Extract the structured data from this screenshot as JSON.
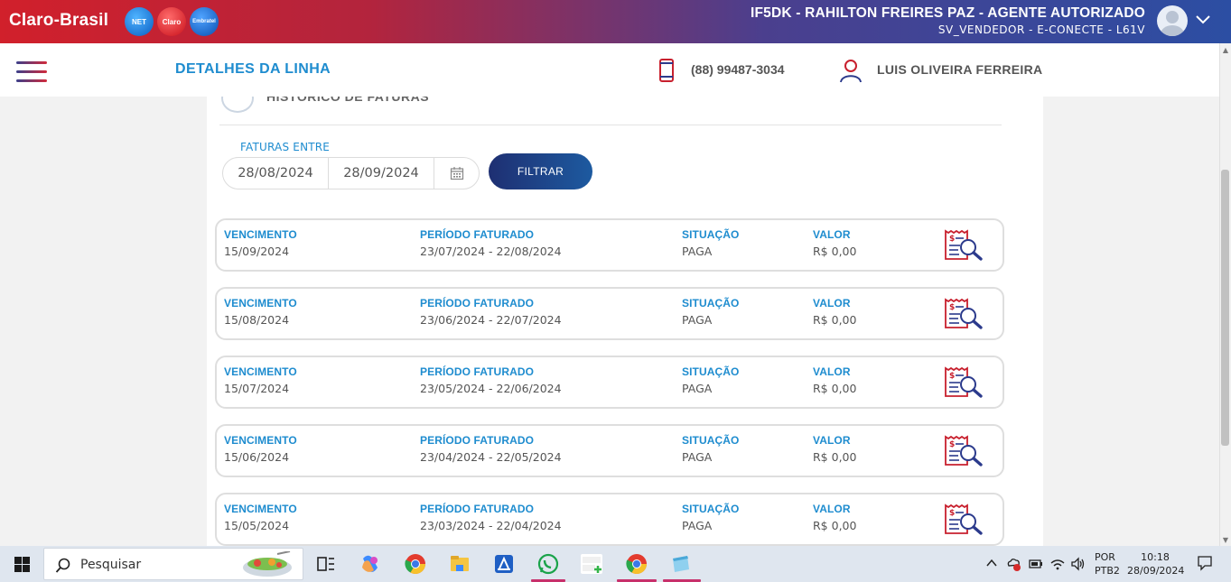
{
  "header": {
    "brand": "Claro-Brasil",
    "badges": [
      "NET",
      "Claro",
      "Embratel"
    ],
    "agent_name": "IF5DK - RAHILTON FREIRES PAZ - AGENTE AUTORIZADO",
    "agent_sub": "SV_VENDEDOR - E-CONECTE - L61V"
  },
  "subheader": {
    "title": "DETALHES DA LINHA",
    "phone": "(88) 99487-3034",
    "customer": "LUIS OLIVEIRA FERREIRA"
  },
  "history": {
    "title": "HISTÓRICO DE FATURAS",
    "filter_label": "FATURAS ENTRE",
    "date_from": "28/08/2024",
    "date_to": "28/09/2024",
    "filter_button": "FILTRAR"
  },
  "columns": {
    "due": "VENCIMENTO",
    "period": "PERÍODO FATURADO",
    "status": "SITUAÇÃO",
    "value": "VALOR"
  },
  "invoices": [
    {
      "due": "15/09/2024",
      "period": "23/07/2024 - 22/08/2024",
      "status": "PAGA",
      "value": "R$ 0,00"
    },
    {
      "due": "15/08/2024",
      "period": "23/06/2024 - 22/07/2024",
      "status": "PAGA",
      "value": "R$ 0,00"
    },
    {
      "due": "15/07/2024",
      "period": "23/05/2024 - 22/06/2024",
      "status": "PAGA",
      "value": "R$ 0,00"
    },
    {
      "due": "15/06/2024",
      "period": "23/04/2024 - 22/05/2024",
      "status": "PAGA",
      "value": "R$ 0,00"
    },
    {
      "due": "15/05/2024",
      "period": "23/03/2024 - 22/04/2024",
      "status": "PAGA",
      "value": "R$ 0,00"
    }
  ],
  "taskbar": {
    "search_placeholder": "Pesquisar",
    "lang_top": "POR",
    "lang_bottom": "PTB2",
    "time": "10:18",
    "date": "28/09/2024",
    "icons": [
      "task-view-icon",
      "copilot-icon",
      "chrome-icon",
      "file-explorer-icon",
      "store-icon",
      "whatsapp-icon",
      "aquitem-icon",
      "chrome-icon",
      "notepad-icon"
    ]
  },
  "colors": {
    "accent_blue": "#1e8ccf",
    "header_red": "#d1202b",
    "header_blue": "#2c4ea3",
    "button_blue": "#1e2f72"
  }
}
